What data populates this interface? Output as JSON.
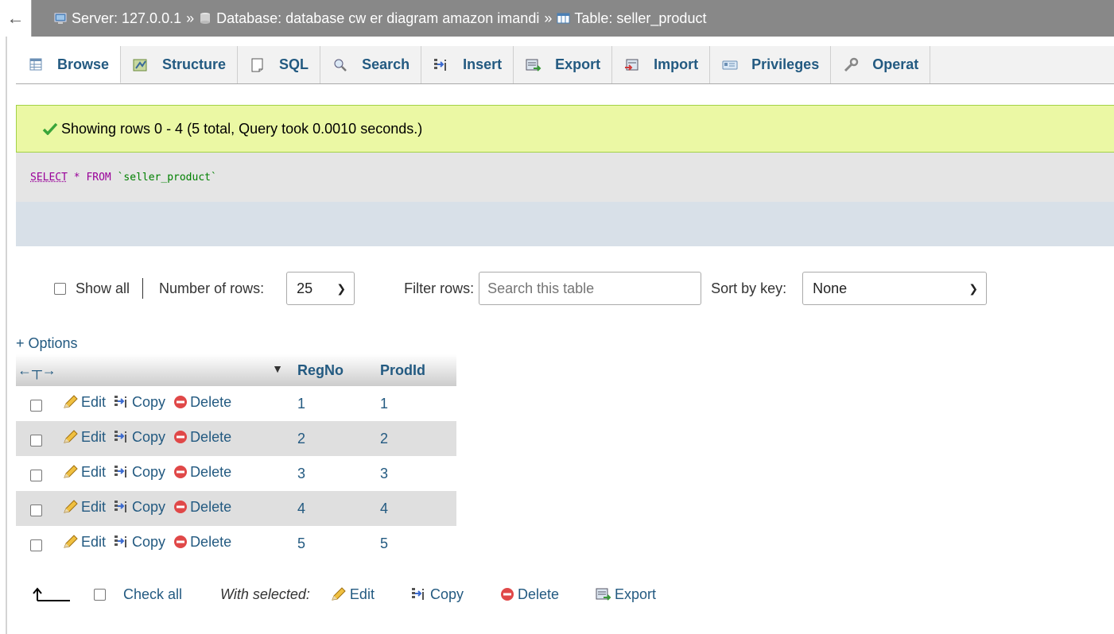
{
  "breadcrumb": {
    "server": "Server: 127.0.0.1",
    "database": "Database: database cw er diagram amazon imandi",
    "table": "Table: seller_product",
    "separator": "»"
  },
  "tabs": [
    {
      "label": "Browse",
      "icon": "table-icon",
      "active": true
    },
    {
      "label": "Structure",
      "icon": "structure-icon"
    },
    {
      "label": "SQL",
      "icon": "sql-icon"
    },
    {
      "label": "Search",
      "icon": "search-icon"
    },
    {
      "label": "Insert",
      "icon": "insert-icon"
    },
    {
      "label": "Export",
      "icon": "export-icon"
    },
    {
      "label": "Import",
      "icon": "import-icon"
    },
    {
      "label": "Privileges",
      "icon": "privileges-icon"
    },
    {
      "label": "Operat",
      "icon": "wrench-icon"
    }
  ],
  "message": "Showing rows 0 - 4 (5 total, Query took 0.0010 seconds.)",
  "sql": {
    "select": "SELECT",
    "star": "*",
    "from": "FROM",
    "table": "`seller_product`"
  },
  "nav": {
    "show_all": "Show all",
    "number_of_rows_label": "Number of rows:",
    "number_of_rows_value": "25",
    "filter_label": "Filter rows:",
    "filter_placeholder": "Search this table",
    "sort_label": "Sort by key:",
    "sort_value": "None"
  },
  "options_link": "+ Options",
  "table": {
    "col_arrows": "←┬→",
    "columns": [
      "RegNo",
      "ProdId"
    ],
    "action_labels": {
      "edit": "Edit",
      "copy": "Copy",
      "delete": "Delete"
    },
    "rows": [
      {
        "RegNo": "1",
        "ProdId": "1"
      },
      {
        "RegNo": "2",
        "ProdId": "2"
      },
      {
        "RegNo": "3",
        "ProdId": "3"
      },
      {
        "RegNo": "4",
        "ProdId": "4"
      },
      {
        "RegNo": "5",
        "ProdId": "5"
      }
    ]
  },
  "bottom": {
    "check_all": "Check all",
    "with_selected": "With selected:",
    "edit": "Edit",
    "copy": "Copy",
    "delete": "Delete",
    "export": "Export"
  },
  "colors": {
    "link": "#235a81",
    "topbar": "#888888",
    "success_bg": "#ebf8a4",
    "row_alt": "#dfdfdf"
  }
}
